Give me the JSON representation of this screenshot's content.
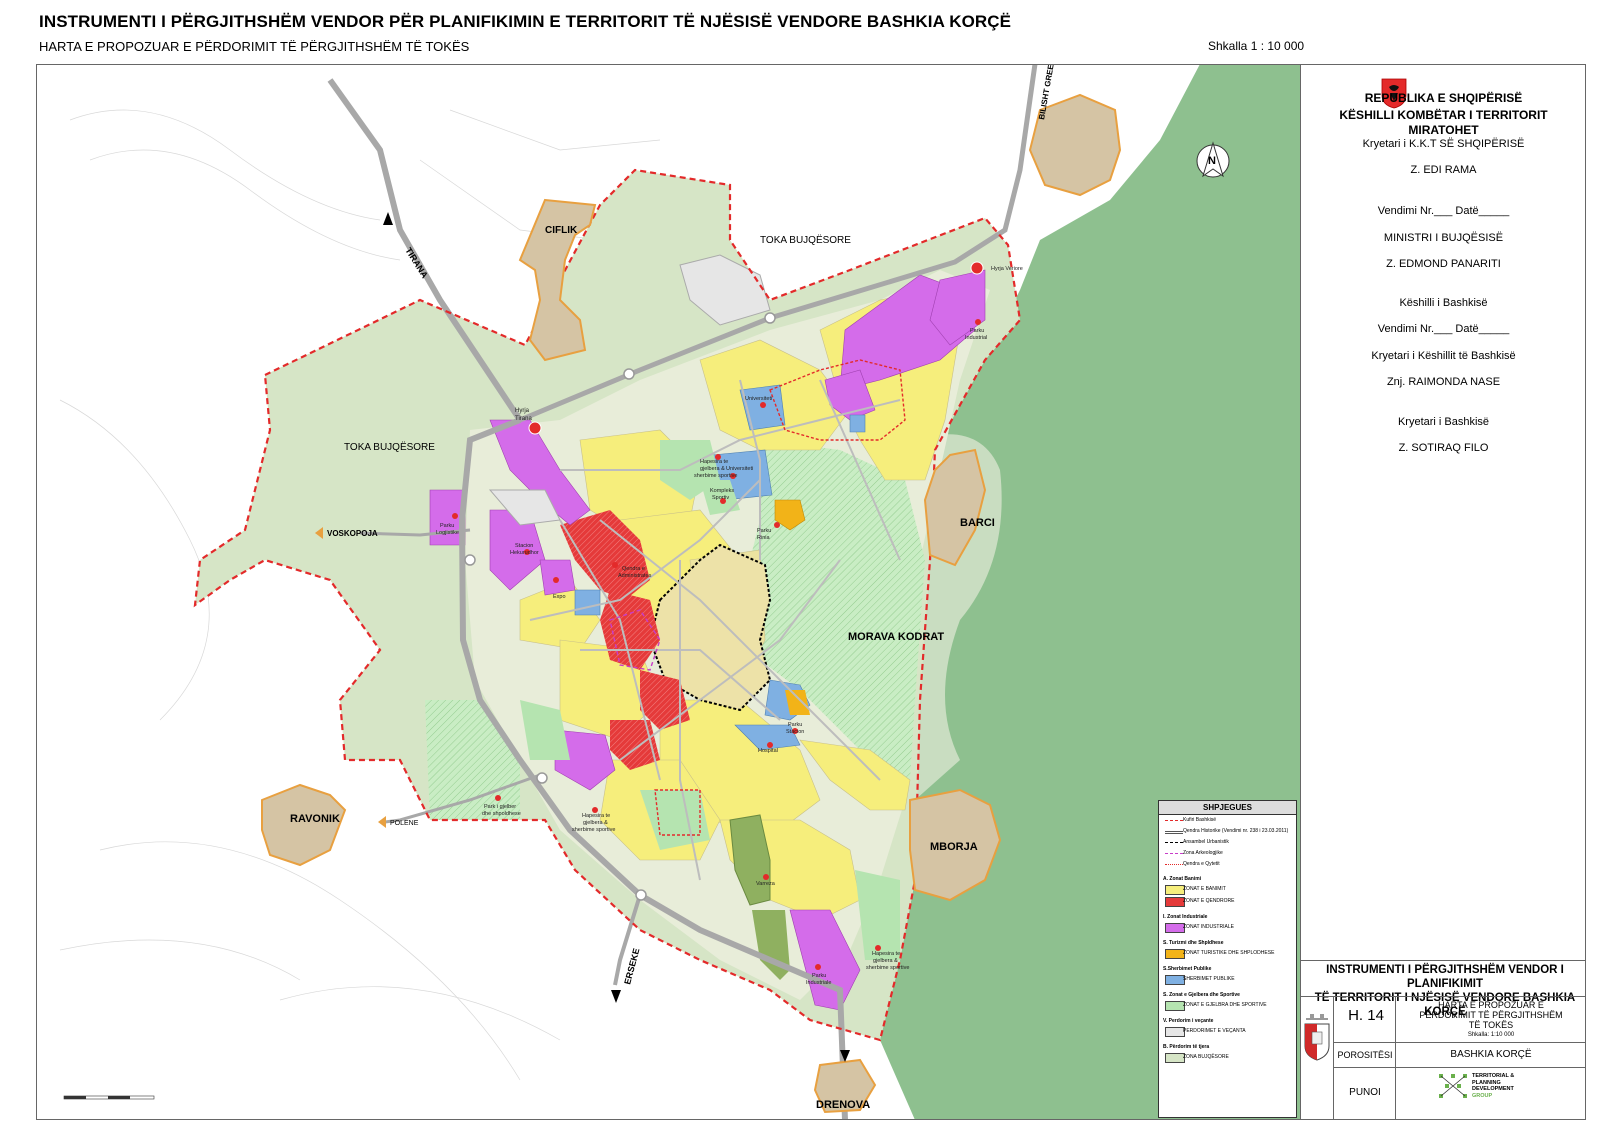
{
  "header": {
    "title": "INSTRUMENTI I PËRGJITHSHËM VENDOR PËR PLANIFIKIMIN E TERRITORIT TË NJËSISË VENDORE BASHKIA KORÇË",
    "subtitle": "HARTA E PROPOZUAR E PËRDORIMIT TË PËRGJITHSHËM TË TOKËS",
    "scale": "Shkalla 1 : 10 000"
  },
  "map": {
    "north_label": "N",
    "place_labels": {
      "ciflik": "CIFLIK",
      "toka_bujq_n": "TOKA BUJQËSORE",
      "toka_bujq_w": "TOKA BUJQËSORE",
      "barci": "BARCI",
      "morava": "MORAVA KODRAT",
      "ravonik": "RAVONIK",
      "mborja": "MBORJA",
      "drenova": "DRENOVA"
    },
    "road_labels": {
      "tirana": "TIRANA",
      "bilisht": "BILISHT GREECE",
      "voskopoja": "VOSKOPOJA",
      "polene": "POLENE",
      "erseke": "ERSEKE"
    },
    "poi_labels": {
      "hyrja_veriore": "Hyrja Veriore",
      "hyrja_tirana_1": "Hyrja",
      "hyrja_tirana_2": "Tirana",
      "parku_ind_ne_1": "Parku",
      "parku_ind_ne_2": "Industrial",
      "universiteti_1": "Universiteti",
      "universiteti_2": "Universiteti",
      "hapesira_1": "Hapesira te",
      "hapesira_2": "gjelbera &",
      "hapesira_3": "sherbime sportive",
      "kompleks_1": "Kompleks",
      "kompleks_2": "Sportiv",
      "parku_rinia_1": "Parku",
      "parku_rinia_2": "Rinia",
      "parku_log_1": "Parku",
      "parku_log_2": "Logjistike",
      "stacion_1": "Stacion",
      "stacion_2": "Hekurudhor",
      "expo": "Expo",
      "parku_sta_1": "Parku",
      "parku_sta_2": "Stacion",
      "hospital": "Hospital",
      "parku_gjelber_1": "Park i gjelber",
      "parku_gjelber_2": "dhe shpoldhese",
      "hap_s_1": "Hapesira te",
      "hap_s_2": "gjelbera &",
      "hap_s_3": "sherbime sportive",
      "varreza": "Varreza",
      "hap_se_1": "Hapesira te",
      "hap_se_2": "gjelbera &",
      "hap_se_3": "sherbime sportive",
      "parku_ind_s_1": "Parku",
      "parku_ind_s_2": "Industriale",
      "qendra_1": "Qendra e",
      "qendra_2": "Administrates"
    },
    "colors": {
      "agri": "#d6e5c6",
      "residential": "#f6ee7c",
      "center": "#e53a3a",
      "industrial": "#d46cea",
      "green": "#b5e4b0",
      "public": "#7fb0e2",
      "tourism": "#f2b318",
      "forest": "#8ec08f",
      "village": "#d5c4a4",
      "village_edge": "#e8a040",
      "boundary": "#e32a2a",
      "road": "#a8a8a8"
    }
  },
  "sidebar": {
    "lines": [
      "REPUBLIKA E SHQIPËRISË",
      "KËSHILLI KOMBËTAR I TERRITORIT",
      "MIRATOHET",
      "Kryetari i K.K.T SË SHQIPËRISË",
      "Z. EDI RAMA",
      "Vendimi Nr.___ Datë_____",
      "MINISTRI I BUJQËSISË",
      "Z. EDMOND PANARITI",
      "Këshilli i Bashkisë",
      "Vendimi Nr.___ Datë_____",
      "Kryetari i Këshillit të Bashkisë",
      "Znj. RAIMONDA NASE",
      "Kryetari i Bashkisë",
      "Z. SOTIRAQ FILO"
    ],
    "title_block": {
      "title_1": "INSTRUMENTI I PËRGJITHSHËM VENDOR I PLANIFIKIMIT",
      "title_2": "TË TERRITORIT I NJËSISË VENDORE BASHKIA KORÇË",
      "sheet": "H. 14",
      "sheet_title_1": "HARTA E PROPOZUAR E",
      "sheet_title_2": "PËRDORIMIT TË PËRGJITHSHËM",
      "sheet_title_3": "TË TOKËS",
      "sheet_scale": "Shkalla: 1:10 000",
      "porositesi_label": "POROSITËSI",
      "porositesi_value": "BASHKIA KORÇË",
      "punoi_label": "PUNOI",
      "punoi_value_1": "TERRITORIAL &",
      "punoi_value_2": "PLANNING",
      "punoi_value_3": "DEVELOPMENT",
      "punoi_value_4": "GROUP"
    }
  },
  "legend": {
    "title": "SHPJEGUES",
    "lines": [
      {
        "label": "Kufiri Bashkisë",
        "color": "#e32a2a",
        "style": "dashed"
      },
      {
        "label": "Qendra Historike (Vendimi nr. 238 i 23.03.2011)",
        "color": "#555",
        "style": "double"
      },
      {
        "label": "Ansambel Urbanistik",
        "color": "#000",
        "style": "dashed"
      },
      {
        "label": "Zona Arkeologjike",
        "color": "#c83cc8",
        "style": "dashed"
      },
      {
        "label": "Qendra e Qytetit",
        "color": "#e32a2a",
        "style": "dotted"
      }
    ],
    "groups": [
      {
        "head": "A. Zonat Banimi",
        "items": [
          {
            "label": "ZONAT E BANIMIT",
            "color": "#f6ee7c"
          },
          {
            "label": "ZONAT E QENDRORE",
            "color": "#e53a3a"
          }
        ]
      },
      {
        "head": "I. Zonat Industriale",
        "items": [
          {
            "label": "ZONAT INDUSTRIALE",
            "color": "#d46cea"
          }
        ]
      },
      {
        "head": "S. Turizmi dhe Shpldhese",
        "items": [
          {
            "label": "ZONAT TURISTIKE DHE SHPLODHESE",
            "color": "#f2b318"
          }
        ]
      },
      {
        "head": "S.Sherbimet Publike",
        "items": [
          {
            "label": "SHERBIMET PUBLIKE",
            "color": "#7fb0e2"
          }
        ]
      },
      {
        "head": "S. Zonat e Gjelbera dhe Sportive",
        "items": [
          {
            "label": "ZONAT E GJELBRA DHE SPORTIVE",
            "color": "#b5e4b0"
          }
        ]
      },
      {
        "head": "V. Perdorim i veçante",
        "items": [
          {
            "label": "PERDORIMET E VEÇANTA",
            "color": "#e6e6e6"
          }
        ]
      },
      {
        "head": "B. Përdorim të tjera",
        "items": [
          {
            "label": "ZONA BUJQËSORE",
            "color": "#d6e5c6"
          }
        ]
      }
    ]
  }
}
